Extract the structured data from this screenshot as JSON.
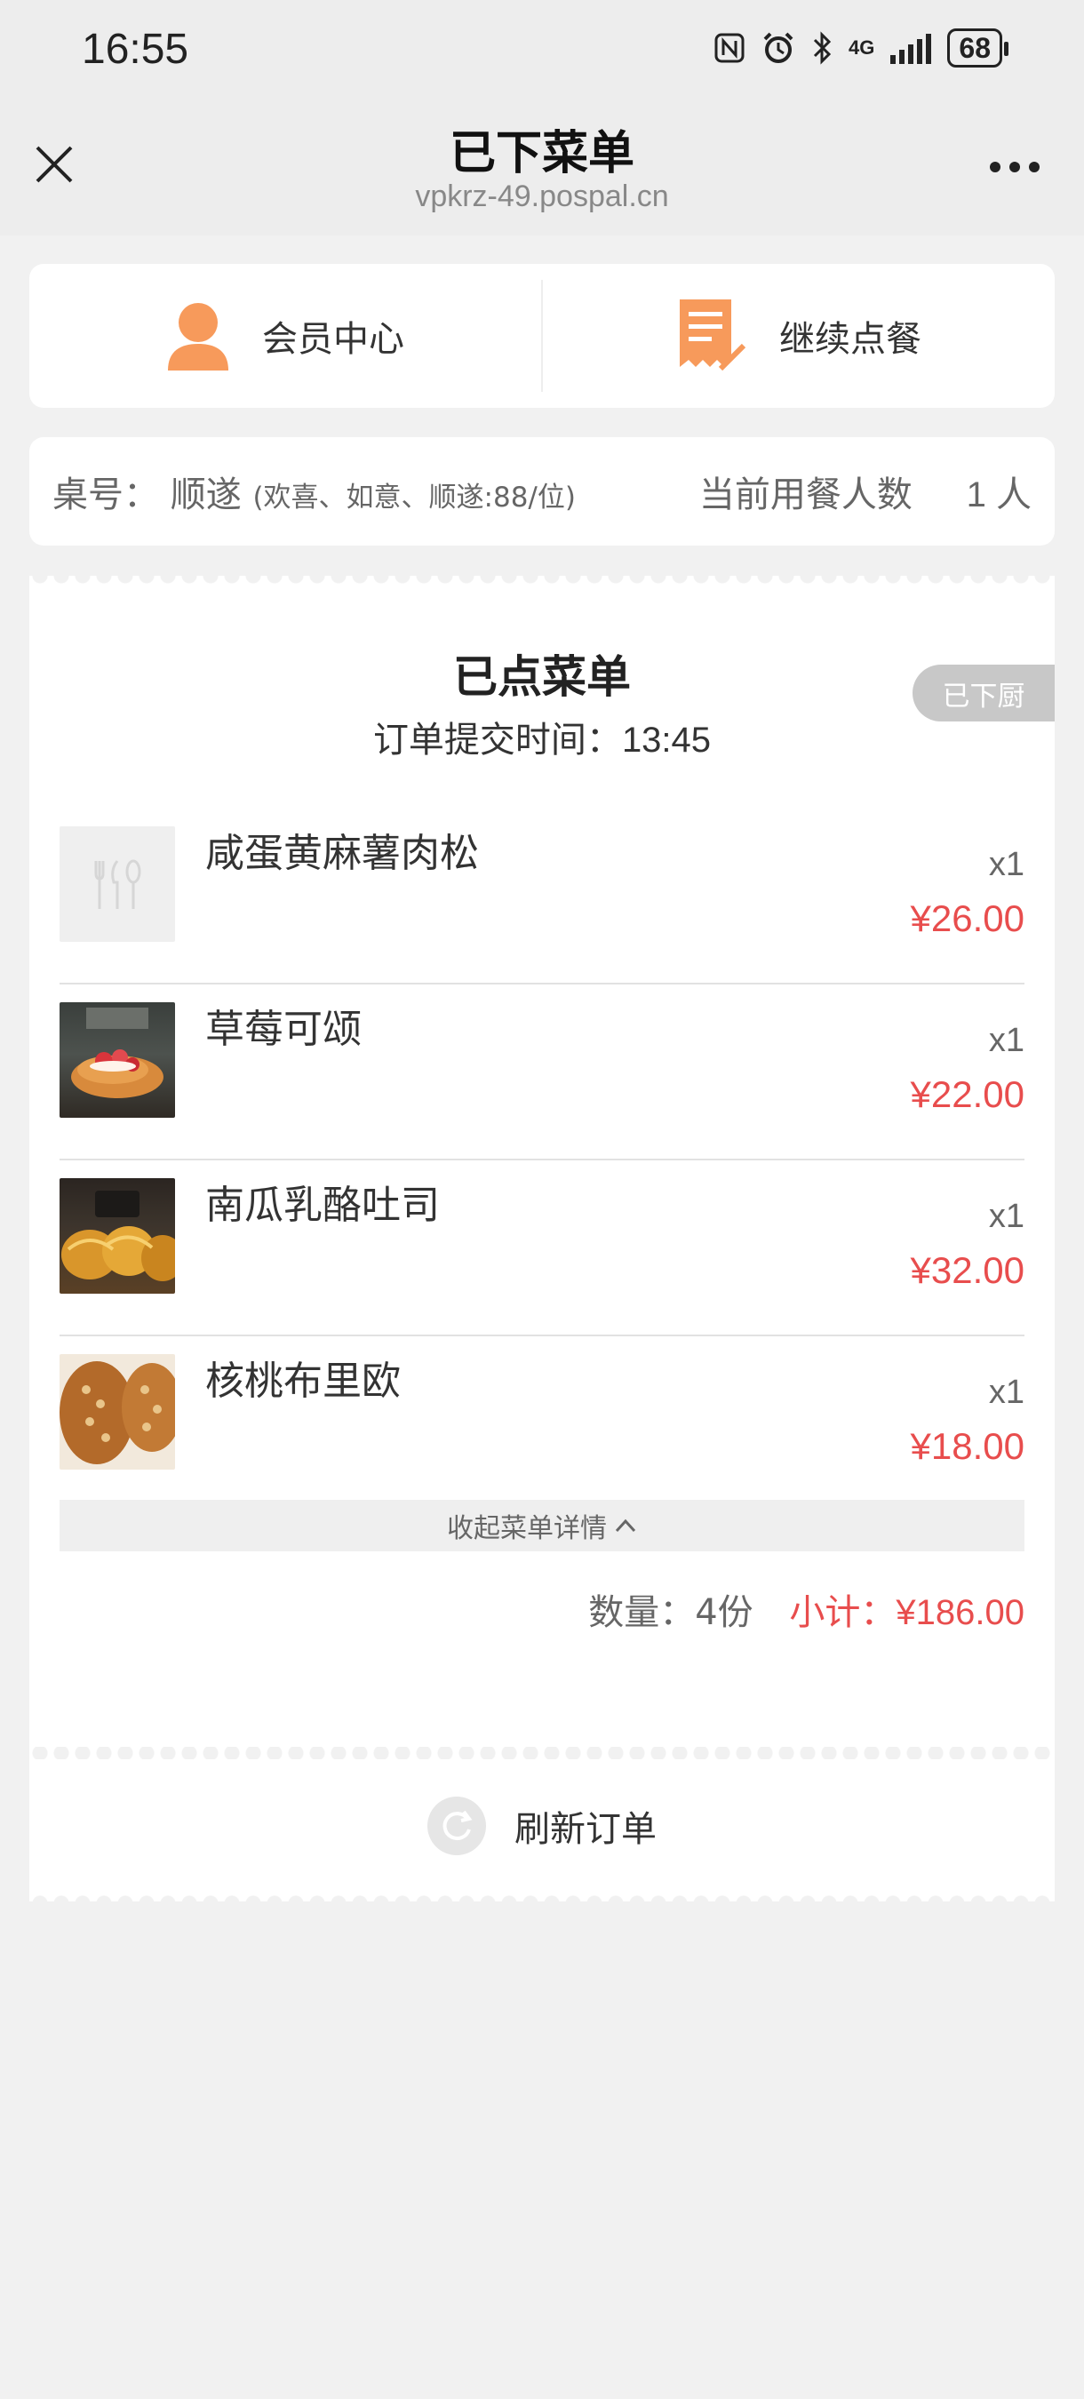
{
  "status_bar": {
    "time": "16:55",
    "network": "4G",
    "battery": "68",
    "icons": [
      "nfc-icon",
      "alarm-icon",
      "bluetooth-icon",
      "signal-icon",
      "battery-icon"
    ]
  },
  "nav": {
    "title": "已下菜单",
    "url": "vpkrz-49.pospal.cn"
  },
  "top_actions": {
    "member_center": "会员中心",
    "continue_order": "继续点餐",
    "accent_color": "#f79a5b"
  },
  "table_info": {
    "label": "桌号：",
    "name": "顺遂",
    "note": "(欢喜、如意、顺遂:88/位)",
    "diners_label": "当前用餐人数",
    "diners_count": "1 人"
  },
  "order": {
    "title": "已点菜单",
    "time_label": "订单提交时间：",
    "time_value": "13:45",
    "status_badge": "已下厨",
    "items": [
      {
        "name": "咸蛋黄麻薯肉松",
        "qty": "x1",
        "price": "¥26.00",
        "image": "placeholder-cutlery"
      },
      {
        "name": "草莓可颂",
        "qty": "x1",
        "price": "¥22.00",
        "image": "strawberry-croissant"
      },
      {
        "name": "南瓜乳酪吐司",
        "qty": "x1",
        "price": "¥32.00",
        "image": "pumpkin-toast"
      },
      {
        "name": "核桃布里欧",
        "qty": "x1",
        "price": "¥18.00",
        "image": "walnut-brioche"
      }
    ],
    "collapse_label": "收起菜单详情",
    "quantity_label": "数量：",
    "quantity_value": "4份",
    "subtotal_label": "小计：",
    "subtotal_value": "¥186.00",
    "refresh_label": "刷新订单",
    "price_color": "#e84d4d"
  }
}
